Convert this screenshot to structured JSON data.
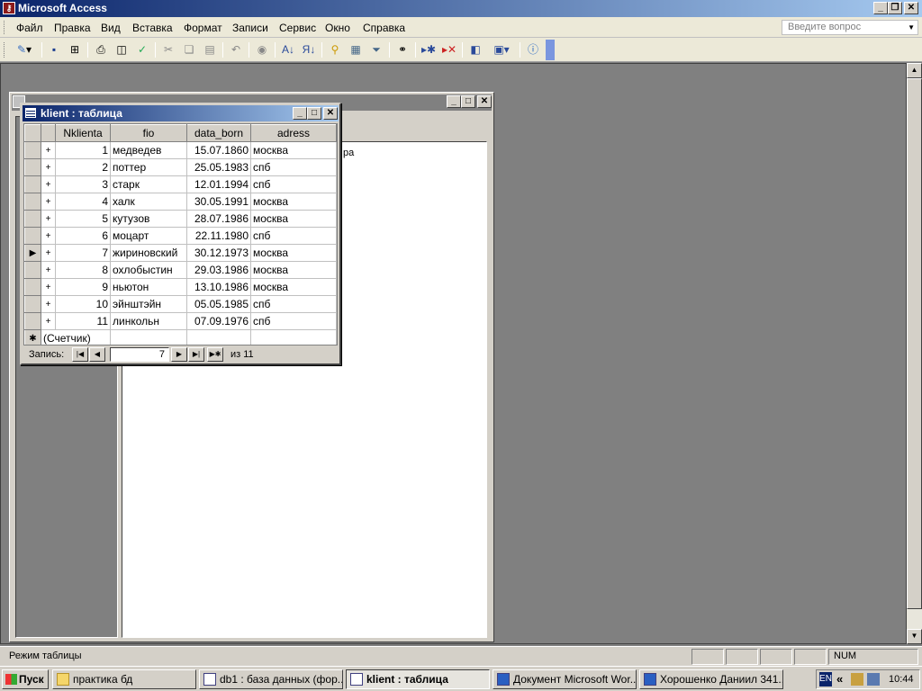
{
  "app": {
    "title": "Microsoft Access"
  },
  "menu": [
    "Файл",
    "Правка",
    "Вид",
    "Вставка",
    "Формат",
    "Записи",
    "Сервис",
    "Окно",
    "Справка"
  ],
  "help_placeholder": "Введите вопрос",
  "toolbar_icons": [
    "design-view-icon",
    "save-icon",
    "search-file-icon",
    "print-icon",
    "print-preview-icon",
    "spellcheck-icon",
    "cut-icon",
    "copy-icon",
    "paste-icon",
    "undo-icon",
    "hyperlink-icon",
    "sort-ascending-icon",
    "sort-descending-icon",
    "filter-selection-icon",
    "filter-form-icon",
    "apply-filter-icon",
    "find-icon",
    "new-record-icon",
    "delete-record-icon",
    "database-window-icon",
    "new-object-icon",
    "help-icon"
  ],
  "background_window": {
    "text_fragment": "ра"
  },
  "table_window": {
    "title": "klient : таблица",
    "columns": [
      "Nklienta",
      "fio",
      "data_born",
      "adress"
    ],
    "rows": [
      [
        "1",
        "медведев",
        "15.07.1860",
        "москва"
      ],
      [
        "2",
        "поттер",
        "25.05.1983",
        "спб"
      ],
      [
        "3",
        "старк",
        "12.01.1994",
        "спб"
      ],
      [
        "4",
        "халк",
        "30.05.1991",
        "москва"
      ],
      [
        "5",
        "кутузов",
        "28.07.1986",
        "москва"
      ],
      [
        "6",
        "моцарт",
        "22.11.1980",
        "спб"
      ],
      [
        "7",
        "жириновский",
        "30.12.1973",
        "москва"
      ],
      [
        "8",
        "охлобыстин",
        "29.03.1986",
        "москва"
      ],
      [
        "9",
        "ньютон",
        "13.10.1986",
        "москва"
      ],
      [
        "10",
        "эйнштэйн",
        "05.05.1985",
        "спб"
      ],
      [
        "11",
        "линкольн",
        "07.09.1976",
        "спб"
      ]
    ],
    "current_row_index": 6,
    "new_row_placeholder": "(Счетчик)",
    "nav": {
      "label": "Запись:",
      "current": "7",
      "of_label": "из 11"
    }
  },
  "status": {
    "text": "Режим таблицы",
    "num": "NUM"
  },
  "taskbar": {
    "start": "Пуск",
    "buttons": [
      {
        "label": "практика бд",
        "active": false
      },
      {
        "label": "db1 : база данных (фор...",
        "active": false
      },
      {
        "label": "klient : таблица",
        "active": true
      },
      {
        "label": "Документ Microsoft Wor...",
        "active": false
      },
      {
        "label": "Хорошенко Даниил 341...",
        "active": false
      }
    ],
    "lang": "EN",
    "clock": "10:44"
  }
}
